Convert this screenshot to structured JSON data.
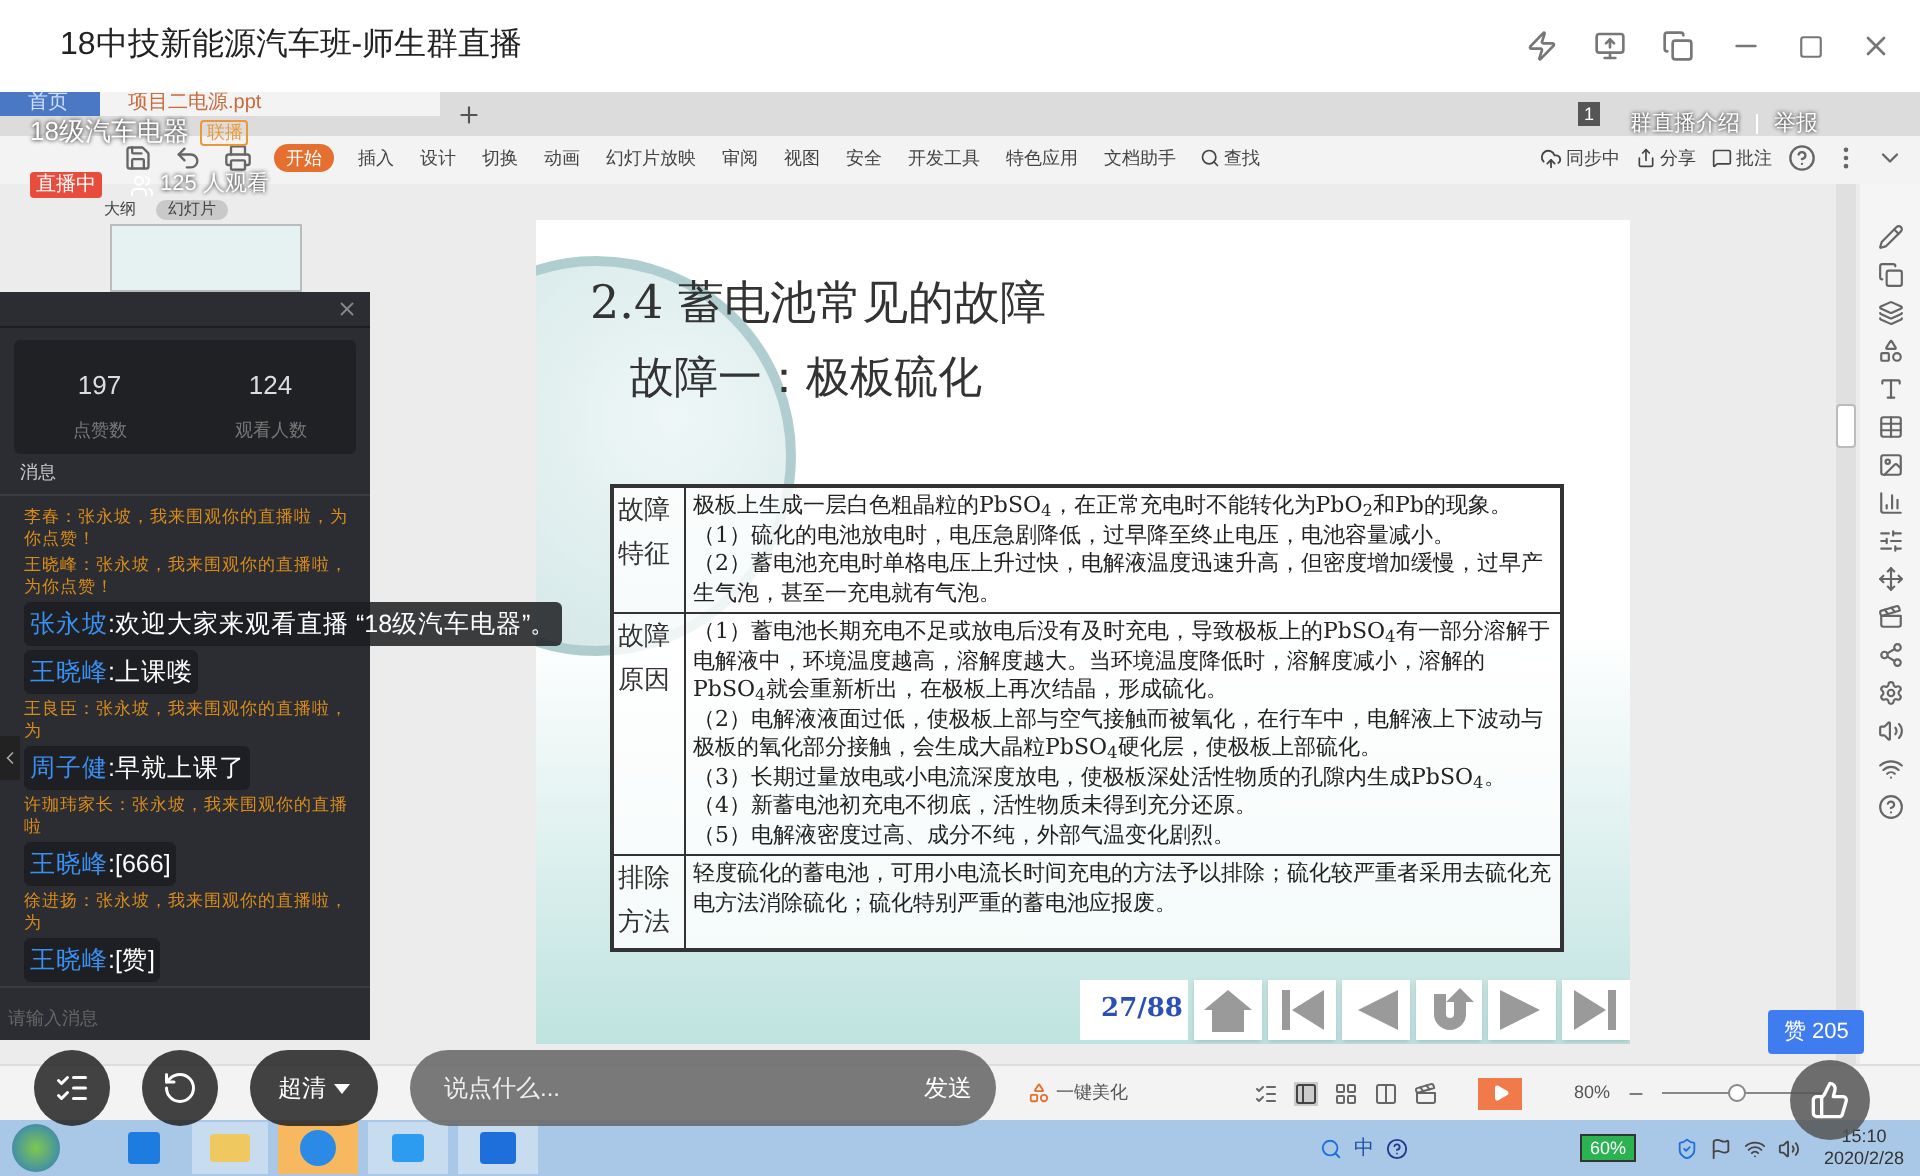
{
  "window": {
    "title": "18中技新能源汽车班-师生群直播"
  },
  "stream": {
    "name": "18级汽车电器",
    "tag": "联播",
    "status": "直播中",
    "viewers": "125 人观看",
    "links": [
      "群直播介绍",
      "举报"
    ]
  },
  "wps": {
    "tabs": [
      {
        "kind": "home",
        "label": "首页",
        "selected": false
      },
      {
        "kind": "doc",
        "label": "项目二电源.ppt",
        "selected": true
      }
    ],
    "window_count": "1",
    "menu": [
      {
        "label": "开始",
        "selected": true
      },
      {
        "label": "插入",
        "selected": false
      },
      {
        "label": "设计",
        "selected": false
      },
      {
        "label": "切换",
        "selected": false
      },
      {
        "label": "动画",
        "selected": false
      },
      {
        "label": "幻灯片放映",
        "selected": false
      },
      {
        "label": "审阅",
        "selected": false
      },
      {
        "label": "视图",
        "selected": false
      },
      {
        "label": "安全",
        "selected": false
      },
      {
        "label": "开发工具",
        "selected": false
      },
      {
        "label": "特色应用",
        "selected": false
      },
      {
        "label": "文档助手",
        "selected": false
      }
    ],
    "search": "查找",
    "actions": [
      "同步中",
      "分享",
      "批注"
    ],
    "pane_tabs": [
      {
        "label": "大纲",
        "selected": false
      },
      {
        "label": "幻灯片",
        "selected": true
      }
    ]
  },
  "slide": {
    "title": "2.4 蓄电池常见的故障",
    "subtitle": "故障一：极板硫化",
    "table": [
      {
        "label": "故障特征",
        "paragraphs": [
          "极板上生成一层白色粗晶粒的PbSO$_{4}$，在正常充电时不能转化为PbO$_{2}$和Pb的现象。",
          "（1）硫化的电池放电时，电压急剧降低，过早降至终止电压，电池容量减小。",
          "（2）蓄电池充电时单格电压上升过快，电解液温度迅速升高，但密度增加缓慢，过早产生气泡，甚至一充电就有气泡。"
        ]
      },
      {
        "label": "故障原因",
        "paragraphs": [
          "（1）蓄电池长期充电不足或放电后没有及时充电，导致极板上的PbSO$_{4}$有一部分溶解于电解液中，环境温度越高，溶解度越大。当环境温度降低时，溶解度减小，溶解的PbSO$_{4}$就会重新析出，在极板上再次结晶，形成硫化。",
          "（2）电解液液面过低，使极板上部与空气接触而被氧化，在行车中，电解液上下波动与极板的氧化部分接触，会生成大晶粒PbSO$_{4}$硬化层，使极板上部硫化。",
          "（3）长期过量放电或小电流深度放电，使极板深处活性物质的孔隙内生成PbSO$_{4}$。",
          "（4）新蓄电池初充电不彻底，活性物质未得到充分还原。",
          "（5）电解液密度过高、成分不纯，外部气温变化剧烈。"
        ]
      },
      {
        "label": "排除方法",
        "paragraphs": [
          "轻度硫化的蓄电池，可用小电流长时间充电的方法予以排除；硫化较严重者采用去硫化充电方法消除硫化；硫化特别严重的蓄电池应报废。"
        ]
      }
    ],
    "page": "27/88"
  },
  "status_bar": {
    "beautify": "一键美化",
    "zoom": "80%",
    "zoom_slider": {
      "level": 0.46
    }
  },
  "chat_panel": {
    "stats": [
      {
        "value": "197",
        "label": "点赞数"
      },
      {
        "value": "124",
        "label": "观看人数"
      }
    ],
    "section": "消息",
    "messages": [
      {
        "kind": "comment",
        "text": "李春：张永坡，我来围观你的直播啦，为你点赞！"
      },
      {
        "kind": "comment",
        "text": "王晓峰：张永坡，我来围观你的直播啦，为你点赞！"
      },
      {
        "kind": "danmaku",
        "name": "张永坡",
        "separator": ":",
        "text": "欢迎大家来观看直播 “18级汽车电器”。"
      },
      {
        "kind": "danmaku",
        "name": "王晓峰",
        "separator": ":",
        "text": "上课喽"
      },
      {
        "kind": "comment",
        "text": "王良臣：张永坡，我来围观你的直播啦，为"
      },
      {
        "kind": "danmaku",
        "name": "周子健",
        "separator": ":",
        "text": "早就上课了"
      },
      {
        "kind": "comment",
        "text": "许珈玮家长：张永坡，我来围观你的直播啦"
      },
      {
        "kind": "danmaku",
        "name": "王晓峰",
        "separator": ":",
        "text": "[666]"
      },
      {
        "kind": "comment",
        "text": "徐进扬：张永坡，我来围观你的直播啦，为"
      },
      {
        "kind": "danmaku",
        "name": "王晓峰",
        "separator": ":",
        "text": "[赞]"
      }
    ],
    "input_placeholder": "请输入消息"
  },
  "controls": {
    "quality": "超清",
    "chat_placeholder": "说点什么...",
    "send": "发送",
    "likes": "赞 205"
  },
  "taskbar": {
    "ime": "中",
    "battery": "60%",
    "time": "15:10",
    "date": "2020/2/28"
  }
}
